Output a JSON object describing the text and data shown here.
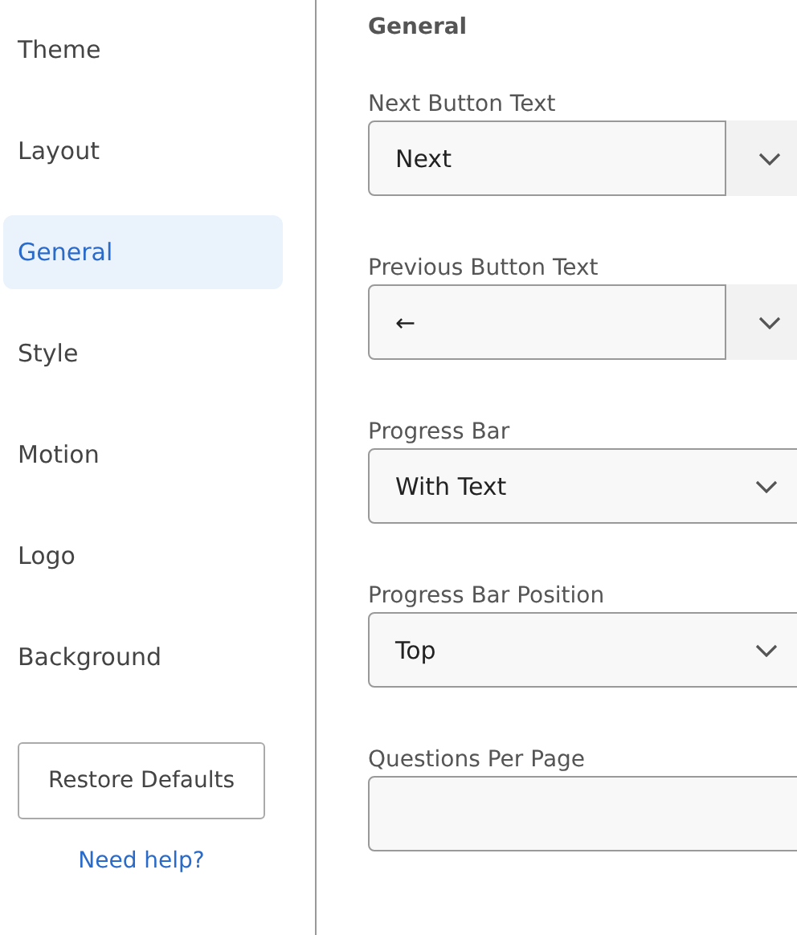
{
  "sidebar": {
    "items": [
      {
        "label": "Theme",
        "selected": false
      },
      {
        "label": "Layout",
        "selected": false
      },
      {
        "label": "General",
        "selected": true
      },
      {
        "label": "Style",
        "selected": false
      },
      {
        "label": "Motion",
        "selected": false
      },
      {
        "label": "Logo",
        "selected": false
      },
      {
        "label": "Background",
        "selected": false
      }
    ],
    "restore_button": "Restore Defaults",
    "help_link": "Need help?"
  },
  "main": {
    "heading": "General",
    "fields": [
      {
        "label": "Next Button Text",
        "kind": "combo",
        "value": "Next"
      },
      {
        "label": "Previous Button Text",
        "kind": "combo",
        "value": "←"
      },
      {
        "label": "Progress Bar",
        "kind": "select",
        "value": "With Text"
      },
      {
        "label": "Progress Bar Position",
        "kind": "select",
        "value": "Top"
      },
      {
        "label": "Questions Per Page",
        "kind": "text"
      }
    ]
  }
}
